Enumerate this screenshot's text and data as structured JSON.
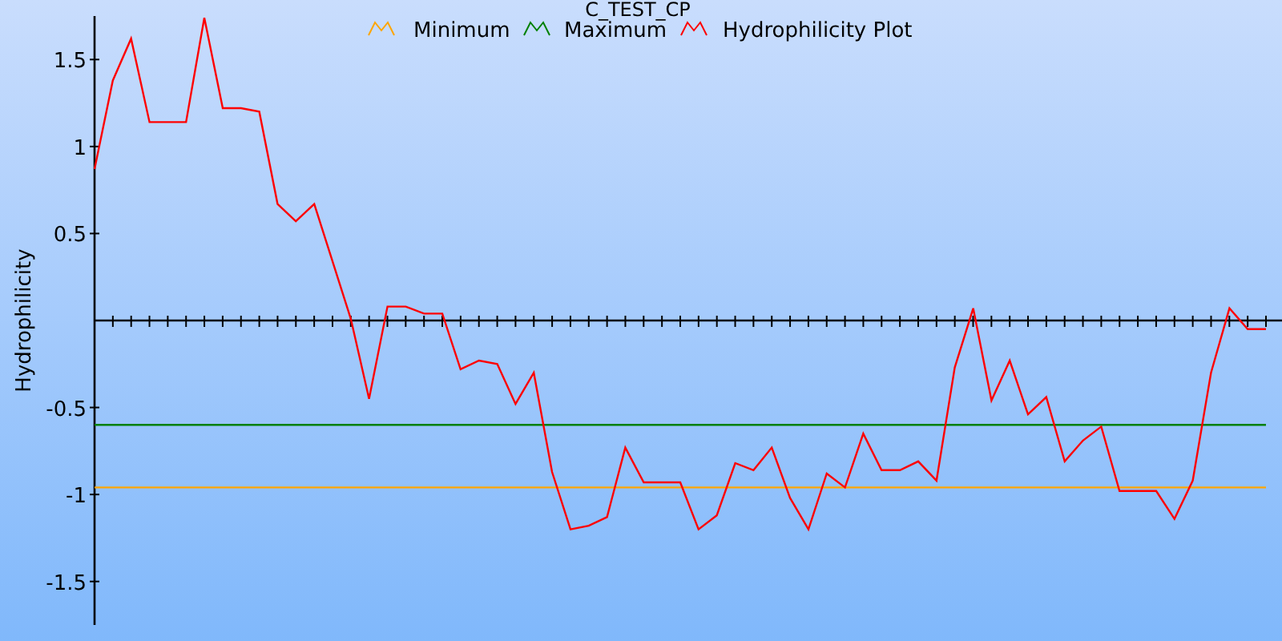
{
  "chart_data": {
    "type": "line",
    "title": "C_TEST_CP",
    "ylabel": "Hydrophilicity",
    "legend": true,
    "ylim": [
      -1.75,
      1.75
    ],
    "yticks": [
      -1.5,
      -1,
      -0.5,
      0.5,
      1,
      1.5
    ],
    "series": [
      {
        "name": "Minimum",
        "color": "#ffa500",
        "values": [
          -0.96,
          -0.96,
          -0.96,
          -0.96,
          -0.96,
          -0.96,
          -0.96,
          -0.96,
          -0.96,
          -0.96,
          -0.96,
          -0.96,
          -0.96,
          -0.96,
          -0.96,
          -0.96,
          -0.96,
          -0.96,
          -0.96,
          -0.96,
          -0.96,
          -0.96,
          -0.96,
          -0.96,
          -0.96,
          -0.96,
          -0.96,
          -0.96,
          -0.96,
          -0.96,
          -0.96,
          -0.96,
          -0.96,
          -0.96,
          -0.96,
          -0.96,
          -0.96,
          -0.96,
          -0.96,
          -0.96,
          -0.96,
          -0.96,
          -0.96,
          -0.96,
          -0.96,
          -0.96,
          -0.96,
          -0.96,
          -0.96,
          -0.96,
          -0.96,
          -0.96,
          -0.96,
          -0.96,
          -0.96,
          -0.96,
          -0.96,
          -0.96,
          -0.96,
          -0.96,
          -0.96,
          -0.96,
          -0.96,
          -0.96,
          -0.96
        ]
      },
      {
        "name": "Maximum",
        "color": "#008000",
        "values": [
          -0.6,
          -0.6,
          -0.6,
          -0.6,
          -0.6,
          -0.6,
          -0.6,
          -0.6,
          -0.6,
          -0.6,
          -0.6,
          -0.6,
          -0.6,
          -0.6,
          -0.6,
          -0.6,
          -0.6,
          -0.6,
          -0.6,
          -0.6,
          -0.6,
          -0.6,
          -0.6,
          -0.6,
          -0.6,
          -0.6,
          -0.6,
          -0.6,
          -0.6,
          -0.6,
          -0.6,
          -0.6,
          -0.6,
          -0.6,
          -0.6,
          -0.6,
          -0.6,
          -0.6,
          -0.6,
          -0.6,
          -0.6,
          -0.6,
          -0.6,
          -0.6,
          -0.6,
          -0.6,
          -0.6,
          -0.6,
          -0.6,
          -0.6,
          -0.6,
          -0.6,
          -0.6,
          -0.6,
          -0.6,
          -0.6,
          -0.6,
          -0.6,
          -0.6,
          -0.6,
          -0.6,
          -0.6,
          -0.6,
          -0.6,
          -0.6
        ]
      },
      {
        "name": "Hydrophilicity Plot",
        "color": "#ff0000",
        "values": [
          0.87,
          1.38,
          1.62,
          1.14,
          1.14,
          1.14,
          1.74,
          1.22,
          1.22,
          1.2,
          0.67,
          0.57,
          0.67,
          0.34,
          0.01,
          -0.45,
          0.08,
          0.08,
          0.04,
          0.04,
          -0.28,
          -0.23,
          -0.25,
          -0.48,
          -0.3,
          -0.87,
          -1.2,
          -1.18,
          -1.13,
          -0.73,
          -0.93,
          -0.93,
          -0.93,
          -1.2,
          -1.12,
          -0.82,
          -0.86,
          -0.73,
          -1.02,
          -1.2,
          -0.88,
          -0.96,
          -0.65,
          -0.86,
          -0.86,
          -0.81,
          -0.92,
          -0.27,
          0.07,
          -0.46,
          -0.23,
          -0.54,
          -0.44,
          -0.81,
          -0.69,
          -0.61,
          -0.98,
          -0.98,
          -0.98,
          -1.14,
          -0.92,
          -0.3,
          0.07,
          -0.05,
          -0.05
        ]
      }
    ]
  }
}
